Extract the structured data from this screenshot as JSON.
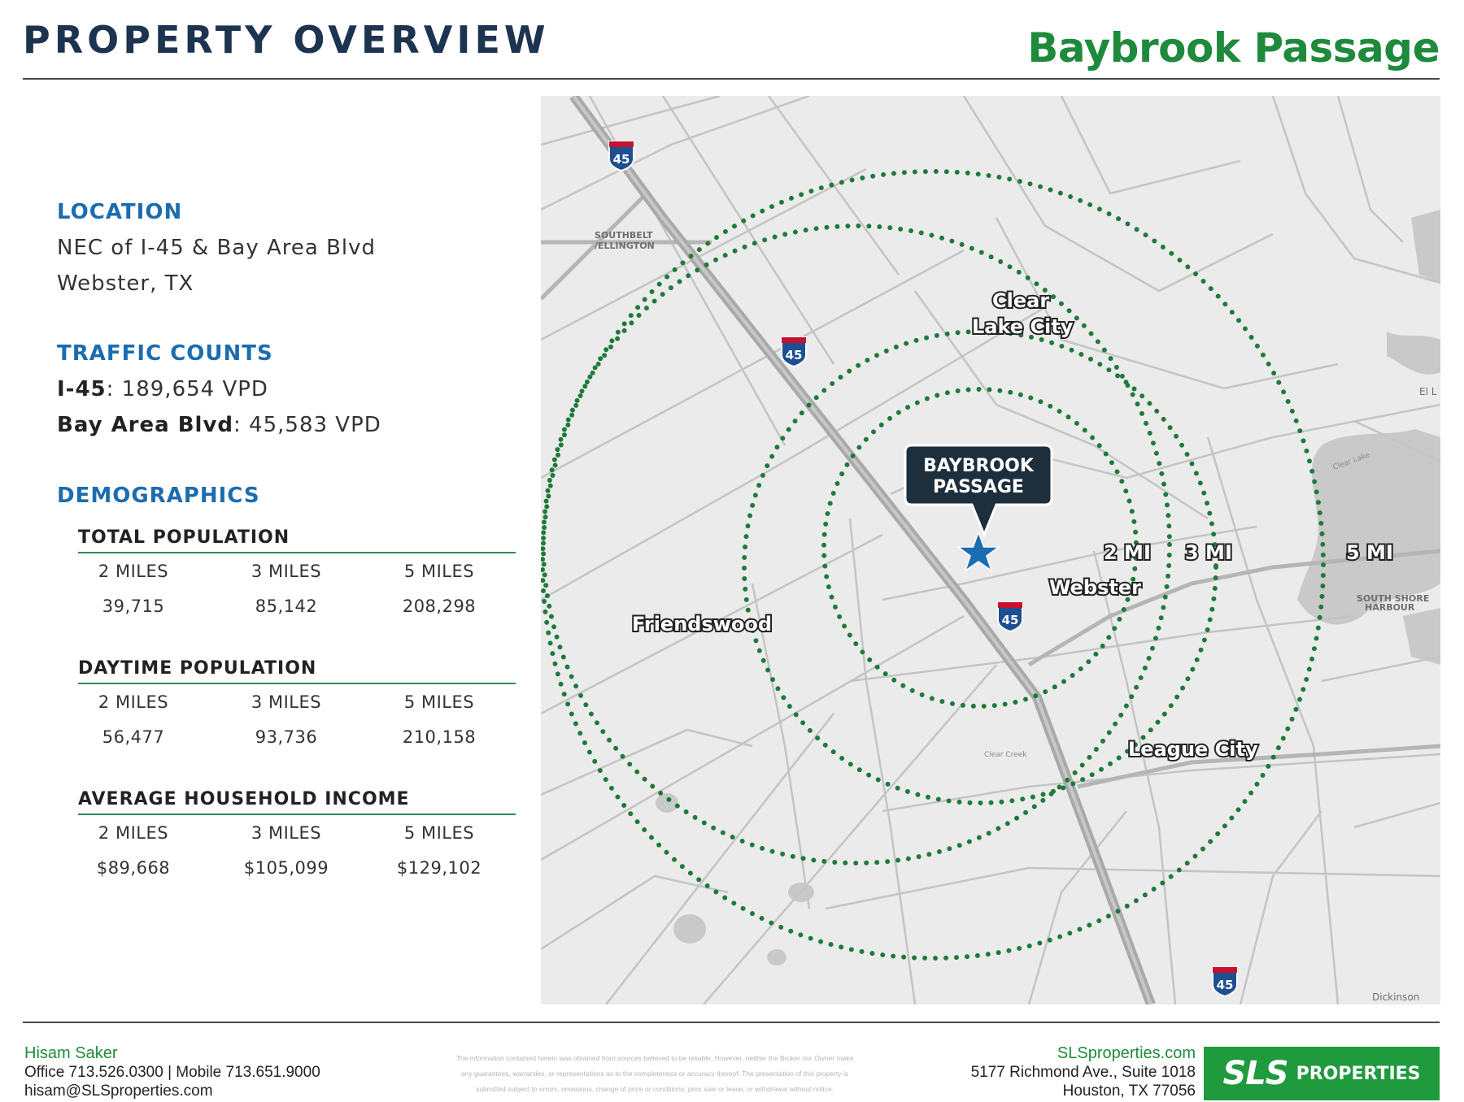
{
  "header": {
    "title": "PROPERTY OVERVIEW",
    "property_name": "Baybrook Passage"
  },
  "location": {
    "heading": "LOCATION",
    "line1": "NEC of I-45 & Bay Area Blvd",
    "line2": "Webster, TX"
  },
  "traffic": {
    "heading": "TRAFFIC COUNTS",
    "items": [
      {
        "road": "I-45",
        "value": ": 189,654 VPD"
      },
      {
        "road": "Bay Area Blvd",
        "value": ": 45,583 VPD"
      }
    ]
  },
  "demographics": {
    "heading": "DEMOGRAPHICS",
    "groups": [
      {
        "title": "TOTAL POPULATION",
        "headers": [
          "2 MILES",
          "3 MILES",
          "5 MILES"
        ],
        "values": [
          "39,715",
          "85,142",
          "208,298"
        ]
      },
      {
        "title": "DAYTIME POPULATION",
        "headers": [
          "2 MILES",
          "3 MILES",
          "5 MILES"
        ],
        "values": [
          "56,477",
          "93,736",
          "210,158"
        ]
      },
      {
        "title": "AVERAGE HOUSEHOLD INCOME",
        "headers": [
          "2 MILES",
          "3 MILES",
          "5 MILES"
        ],
        "values": [
          "$89,668",
          "$105,099",
          "$129,102"
        ]
      }
    ]
  },
  "map": {
    "pin_label_line1": "BAYBROOK",
    "pin_label_line2": "PASSAGE",
    "rings": [
      "2 MI",
      "3 MI",
      "5 MI"
    ],
    "places": [
      "Clear",
      "Lake City",
      "Friendswood",
      "Webster",
      "League City"
    ],
    "small_labels": [
      "SOUTHBELT",
      "/ELLINGTON",
      "SOUTH SHORE",
      "HARBOUR",
      "Dickinson",
      "El L",
      "Clear Lake",
      "Clear Creek"
    ],
    "shields": [
      "45",
      "45",
      "45",
      "45"
    ],
    "colors": {
      "ring": "#1f7a3a",
      "star": "#1b6cb0",
      "callout": "#1d2e3c",
      "land": "#ebebeb",
      "water": "#c8c8c8"
    }
  },
  "footer": {
    "name": "Hisam Saker",
    "phones": "Office 713.526.0300 | Mobile 713.651.9000",
    "email": "hisam@SLSproperties.com",
    "disclaimer1": "The information contained herein was obtained from sources believed to be reliable. However, neither the Broker nor Owner make",
    "disclaimer2": "any guarantees, warranties, or representations as to the completeness or accuracy thereof. The presentation of this property is",
    "disclaimer3": "submitted subject to errors, omissions, change of price or conditions, prior sale or lease, or withdrawal without notice.",
    "website": "SLSproperties.com",
    "address1": "5177 Richmond Ave., Suite 1018",
    "address2": "Houston, TX 77056",
    "logo_mark": "SLS",
    "logo_text": "PROPERTIES"
  }
}
